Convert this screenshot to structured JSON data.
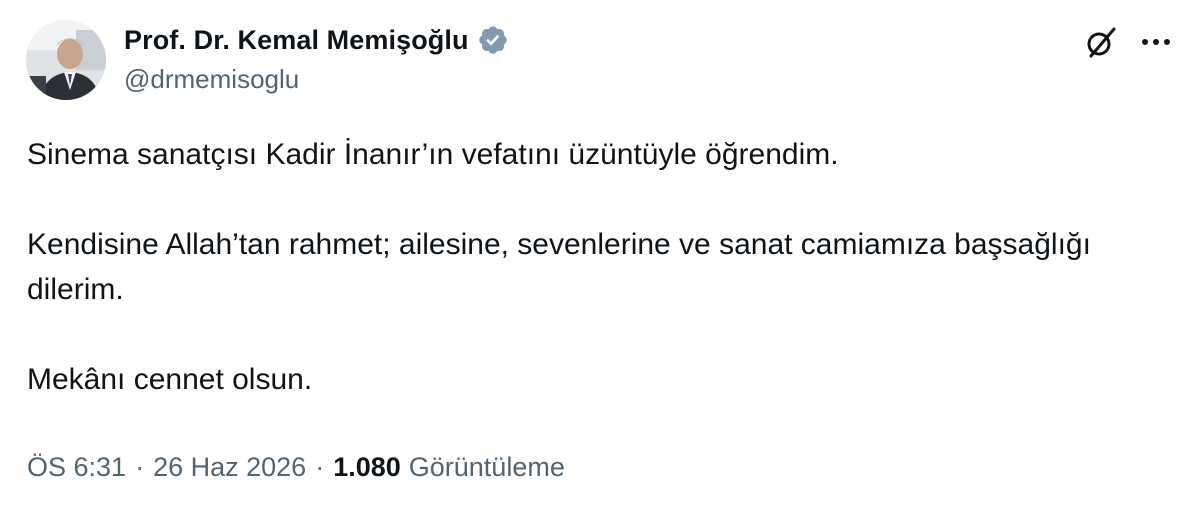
{
  "author": {
    "display_name": "Prof. Dr. Kemal Memişoğlu",
    "handle": "@drmemisoglu",
    "verified_color": "#829aab"
  },
  "icons": {
    "verified": "verified-badge-icon",
    "grok": "grok-icon",
    "more": "more-options-icon"
  },
  "tweet": {
    "paragraphs": [
      "Sinema sanatçısı Kadir İnanır’ın vefatını üzüntüyle öğrendim.",
      "Kendisine Allah’tan rahmet; ailesine, sevenlerine ve sanat camiamıza başsağlığı dilerim.",
      "Mekânı cennet olsun."
    ]
  },
  "meta": {
    "time": "ÖS 6:31",
    "separator": "·",
    "date": "26 Haz 2026",
    "views_count": "1.080",
    "views_label": "Görüntüleme"
  }
}
